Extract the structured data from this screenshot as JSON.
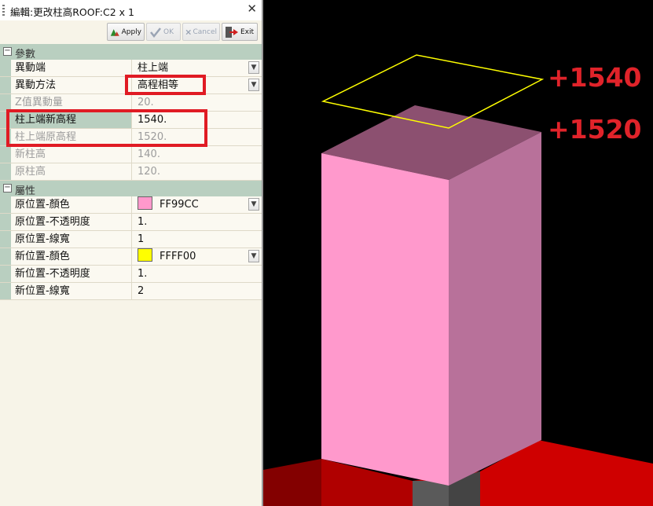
{
  "window": {
    "title": "編輯:更改柱高ROOF:C2 x 1",
    "close_glyph": "✕"
  },
  "toolbar": {
    "apply_label": "Apply",
    "ok_label": "OK",
    "cancel_label": "Cancel",
    "exit_label": "Exit"
  },
  "categories": [
    {
      "label": "參數",
      "toggle": "−",
      "rows": [
        {
          "name": "異動端",
          "value": "柱上端",
          "readonly": false,
          "dropdown": true
        },
        {
          "name": "異動方法",
          "value": "高程相等",
          "readonly": false,
          "dropdown": true
        },
        {
          "name": "Z值異動量",
          "value": "20.",
          "readonly": true,
          "dropdown": false
        },
        {
          "name": "柱上端新高程",
          "value": "1540.",
          "readonly": false,
          "dropdown": false
        },
        {
          "name": "柱上端原高程",
          "value": "1520.",
          "readonly": true,
          "dropdown": false
        },
        {
          "name": "新柱高",
          "value": "140.",
          "readonly": true,
          "dropdown": false
        },
        {
          "name": "原柱高",
          "value": "120.",
          "readonly": true,
          "dropdown": false
        }
      ]
    },
    {
      "label": "屬性",
      "toggle": "−",
      "rows": [
        {
          "name": "原位置-顏色",
          "value": "FF99CC",
          "swatch": "#FF99CC",
          "readonly": false,
          "dropdown": true
        },
        {
          "name": "原位置-不透明度",
          "value": "1.",
          "readonly": false,
          "dropdown": false
        },
        {
          "name": "原位置-線寬",
          "value": "1",
          "readonly": false,
          "dropdown": false
        },
        {
          "name": "新位置-顏色",
          "value": "FFFF00",
          "swatch": "#FFFF00",
          "readonly": false,
          "dropdown": true
        },
        {
          "name": "新位置-不透明度",
          "value": "1.",
          "readonly": false,
          "dropdown": false
        },
        {
          "name": "新位置-線寬",
          "value": "2",
          "readonly": false,
          "dropdown": false
        }
      ]
    }
  ],
  "viewport": {
    "new_elevation_label": "+1540",
    "original_elevation_label": "+1520",
    "colors": {
      "column_front": "#ff99cc",
      "column_side": "#b8719a",
      "column_top": "#8c5070",
      "outline_new": "#ffff00",
      "floor": "#d00000",
      "annotation": "#e0232a",
      "background": "#000000"
    }
  }
}
